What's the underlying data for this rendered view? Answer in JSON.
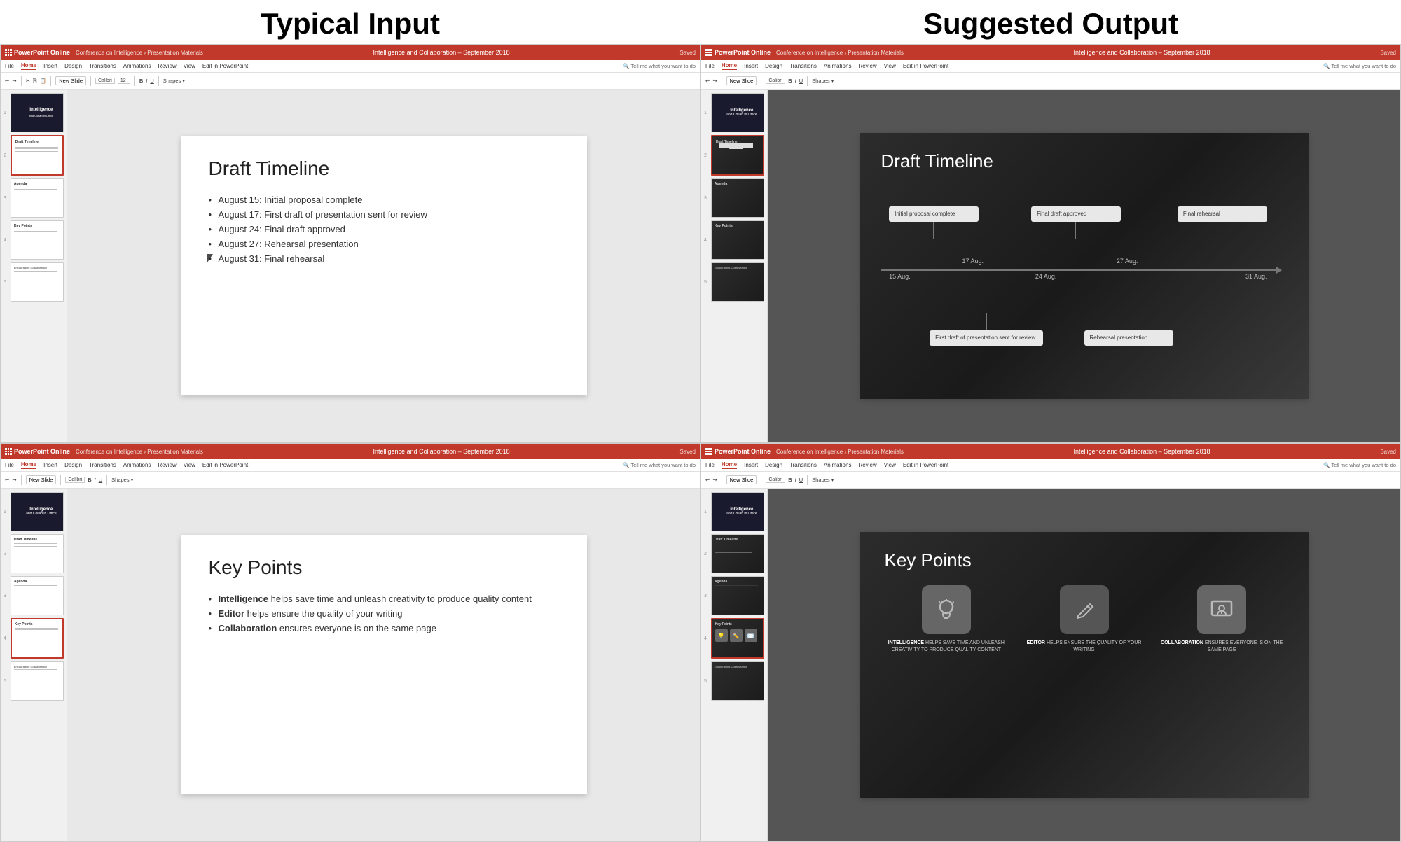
{
  "header": {
    "left_title": "Typical Input",
    "right_title": "Suggested Output"
  },
  "ppt": {
    "app_name": "PowerPoint Online",
    "breadcrumb": "Conference on Intelligence › Presentation Materials",
    "filename": "Intelligence and Collaboration – September 2018",
    "saved": "Saved",
    "menu_items": [
      "File",
      "Home",
      "Insert",
      "Design",
      "Transitions",
      "Animations",
      "Review",
      "View",
      "Edit in PowerPoint"
    ],
    "active_menu": "Home",
    "tell_me": "Tell me what you want to do",
    "new_slide": "New Slide"
  },
  "slide2_input": {
    "title": "Draft Timeline",
    "bullets": [
      "August 15: Initial proposal complete",
      "August 17: First draft of presentation sent for review",
      "August 24: Final draft approved",
      "August 27: Rehearsal presentation",
      "August 31: Final rehearsal"
    ]
  },
  "slide2_output": {
    "title": "Draft Timeline",
    "events_above": [
      {
        "label": "Initial proposal complete",
        "date": "15 Aug.",
        "left_pct": 8
      },
      {
        "label": "Final draft approved",
        "date": "24 Aug.",
        "left_pct": 42
      },
      {
        "label": "Final rehearsal",
        "date": "31 Aug.",
        "left_pct": 76
      }
    ],
    "events_below": [
      {
        "label": "First draft of presentation sent for review",
        "date": "17 Aug.",
        "left_pct": 20
      },
      {
        "label": "Rehearsal presentation",
        "date": "27 Aug.",
        "left_pct": 58
      }
    ],
    "dates_on_line": [
      "15 Aug.",
      "17 Aug.",
      "24 Aug.",
      "27 Aug.",
      "31 Aug."
    ]
  },
  "slide4_input": {
    "title": "Key Points",
    "bullets": [
      {
        "bold": "Intelligence",
        "rest": " helps save time and unleash creativity to produce quality content"
      },
      {
        "bold": "Editor",
        "rest": " helps ensure the quality of your writing"
      },
      {
        "bold": "Collaboration",
        "rest": " ensures everyone is on the same page"
      }
    ]
  },
  "slide4_output": {
    "title": "Key Points",
    "icons": [
      {
        "symbol": "💡",
        "label_bold": "INTELLIGENCE",
        "label_rest": " HELPS SAVE TIME AND UNLEASH CREATIVITY TO PRODUCE QUALITY CONTENT"
      },
      {
        "symbol": "✏️",
        "label_bold": "EDITOR",
        "label_rest": " HELPS ENSURE THE QUALITY OF YOUR WRITING"
      },
      {
        "symbol": "✉️",
        "label_bold": "COLLABORATION",
        "label_rest": " ENSURES EVERYONE IS ON THE SAME PAGE"
      }
    ]
  },
  "slide_thumbs": {
    "count": 5,
    "labels": [
      "slide1",
      "slide2",
      "slide3",
      "slide4",
      "slide5"
    ]
  }
}
